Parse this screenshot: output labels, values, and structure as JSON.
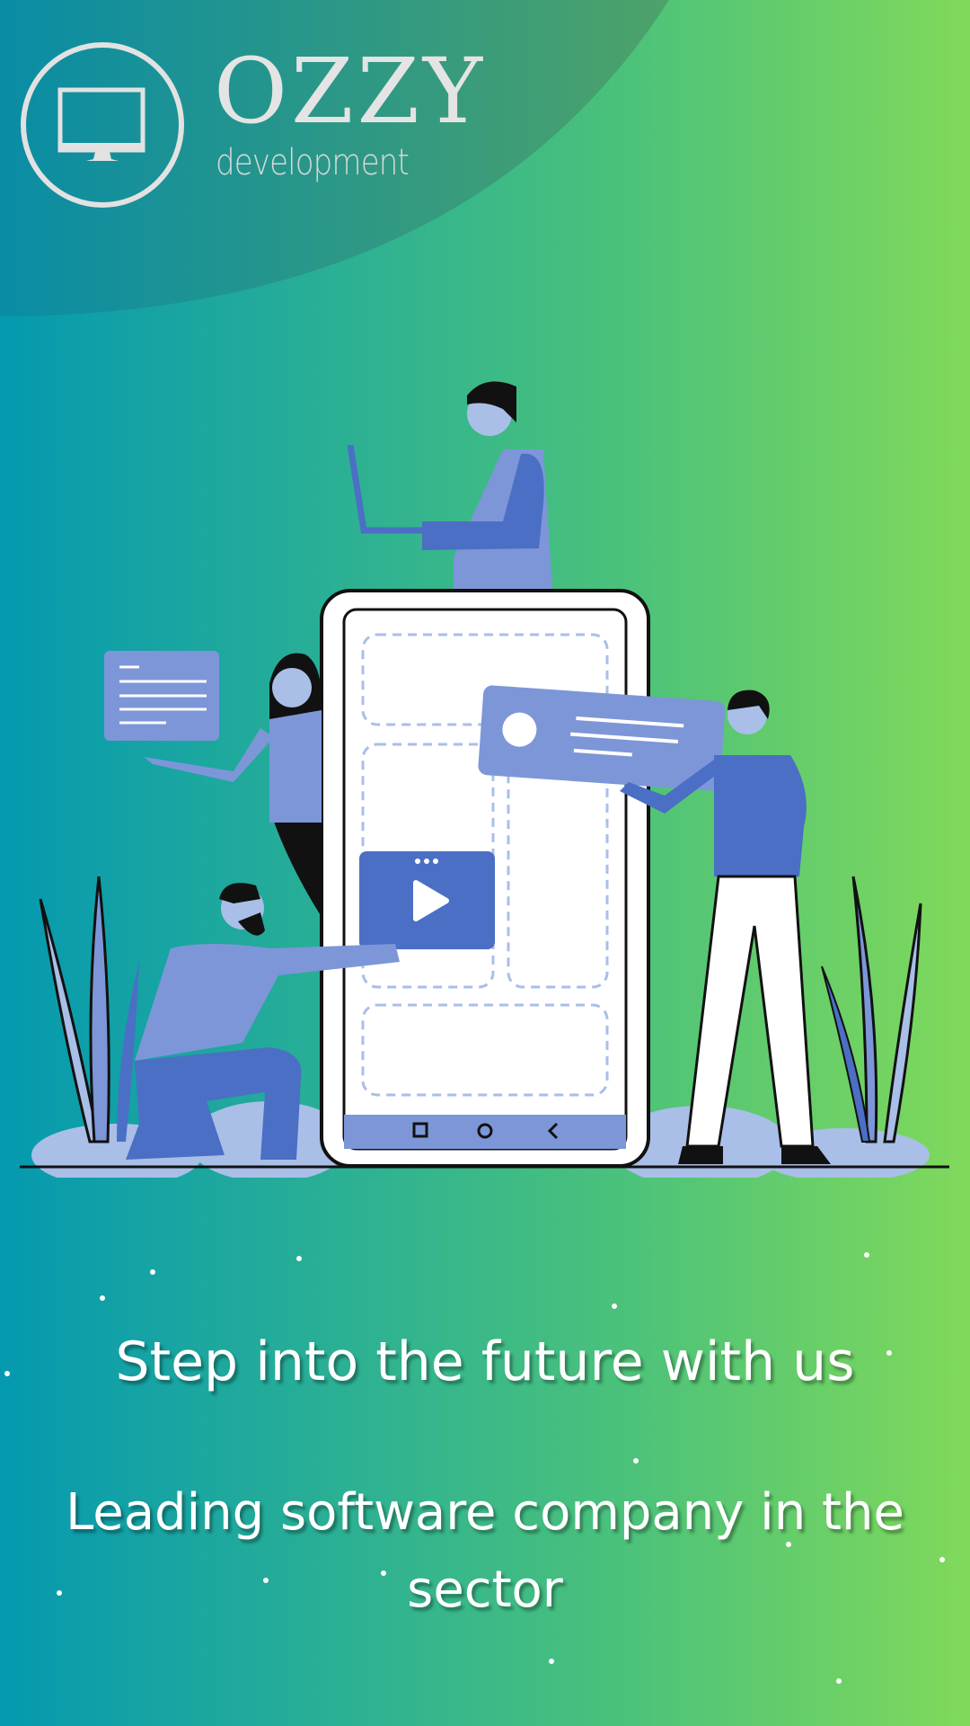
{
  "logo": {
    "brand": "OZZY",
    "tagline": "development",
    "icon": "monitor-icon"
  },
  "hero": {
    "headline": "Step into the future with us",
    "subheadline": "Leading software company in the sector"
  },
  "colors": {
    "gradient_start": "#0599b0",
    "gradient_end": "#80d95a",
    "illustration_blue": "#4b6fc4",
    "illustration_light": "#7d96d8"
  }
}
